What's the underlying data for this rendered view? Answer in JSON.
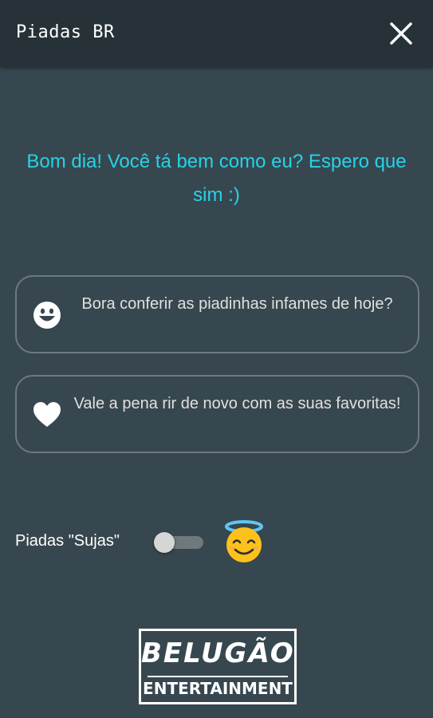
{
  "header": {
    "title": "Piadas BR",
    "close_icon": "close-icon"
  },
  "greeting": "Bom dia! Você tá bem como eu? Espero que sim :)",
  "options": [
    {
      "icon": "smiley-icon",
      "label": "Bora conferir as piadinhas infames de hoje?"
    },
    {
      "icon": "heart-icon",
      "label": "Vale a pena rir de novo com as suas favoritas!"
    }
  ],
  "dirty_jokes": {
    "label": "Piadas \"Sujas\"",
    "enabled": false,
    "emoji": "angel-face-emoji"
  },
  "logo": {
    "top": "BELUGÃO",
    "bottom": "ENTERTAINMENT"
  },
  "colors": {
    "background": "#37474f",
    "topbar": "#263238",
    "accent": "#26d3e8"
  }
}
